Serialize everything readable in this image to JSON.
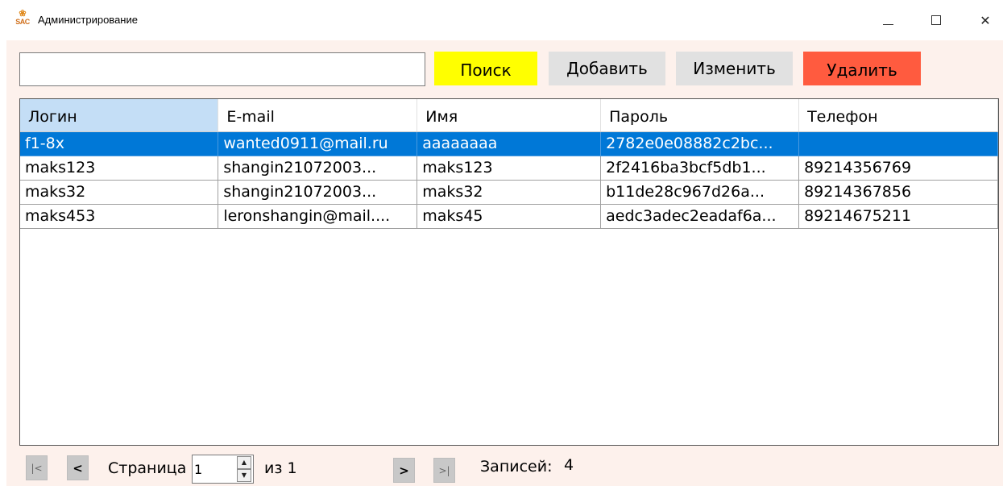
{
  "window": {
    "title": "Администрирование",
    "icon_top": "❀",
    "icon_text": "SAC",
    "minimize_glyph": "",
    "close_glyph": "✕"
  },
  "toolbar": {
    "search_value": "",
    "search_label": "Поиск",
    "add_label": "Добавить",
    "edit_label": "Изменить",
    "delete_label": "Удалить"
  },
  "colors": {
    "search_button": "#ffff00",
    "delete_button": "#ff5b3f",
    "selected_row": "#0078d7",
    "selected_header": "#c4def6",
    "background": "#fdf1ec"
  },
  "table": {
    "columns": [
      "Логин",
      "E-mail",
      "Имя",
      "Пароль",
      "Телефон"
    ],
    "selected_column": 0,
    "selected_row": 0,
    "rows": [
      [
        "f1-8x",
        "wanted0911@mail.ru",
        "aaaaaaaa",
        "2782e0e08882c2bc...",
        ""
      ],
      [
        "maks123",
        "shangin21072003...",
        "maks123",
        "2f2416ba3bcf5db1...",
        "89214356769"
      ],
      [
        "maks32",
        "shangin21072003...",
        "maks32",
        "b11de28c967d26a...",
        "89214367856"
      ],
      [
        "maks453",
        "leronshangin@mail....",
        "maks45",
        "aedc3adec2eadaf6a...",
        "89214675211"
      ]
    ]
  },
  "pager": {
    "first_label": "|<",
    "prev_label": "<",
    "page_label": "Страница",
    "page_value": "1",
    "total_label": "из 1",
    "next_label": ">",
    "last_label": ">|",
    "records_label": "Записей:",
    "records_count": "4"
  }
}
